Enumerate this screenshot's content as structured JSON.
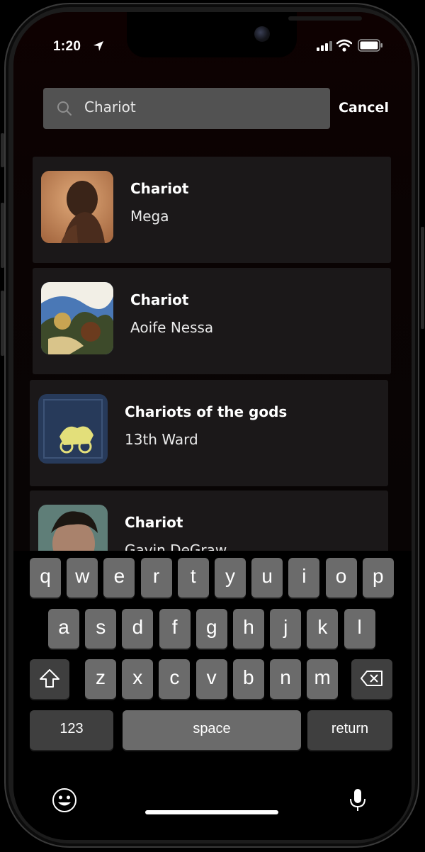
{
  "status_bar": {
    "time": "1:20"
  },
  "search": {
    "query": "Chariot",
    "cancel_label": "Cancel"
  },
  "results": [
    {
      "title": "Chariot",
      "artist": "Mega"
    },
    {
      "title": "Chariot",
      "artist": "Aoife Nessa"
    },
    {
      "title": "Chariots of the gods",
      "artist": "13th Ward"
    },
    {
      "title": "Chariot",
      "artist": "Gavin DeGraw"
    }
  ],
  "keyboard": {
    "row1": [
      "q",
      "w",
      "e",
      "r",
      "t",
      "y",
      "u",
      "i",
      "o",
      "p"
    ],
    "row2": [
      "a",
      "s",
      "d",
      "f",
      "g",
      "h",
      "j",
      "k",
      "l"
    ],
    "row3": [
      "z",
      "x",
      "c",
      "v",
      "b",
      "n",
      "m"
    ],
    "numbers_label": "123",
    "space_label": "space",
    "return_label": "return"
  },
  "icons": {
    "search": "search-icon",
    "shift": "shift-icon",
    "backspace": "backspace-icon",
    "emoji": "emoji-icon",
    "microphone": "microphone-icon"
  },
  "colors": {
    "search_bar_bg": "#525252",
    "row_bg": "#1b1819",
    "key_bg": "#6b6b6b",
    "key_dark_bg": "#3f3f3f"
  }
}
